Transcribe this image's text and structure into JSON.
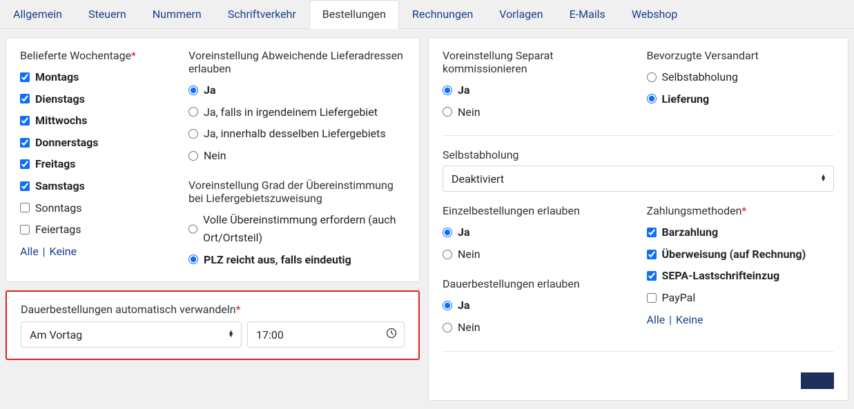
{
  "tabs": {
    "items": [
      {
        "label": "Allgemein",
        "active": false
      },
      {
        "label": "Steuern",
        "active": false
      },
      {
        "label": "Nummern",
        "active": false
      },
      {
        "label": "Schriftverkehr",
        "active": false
      },
      {
        "label": "Bestellungen",
        "active": true
      },
      {
        "label": "Rechnungen",
        "active": false
      },
      {
        "label": "Vorlagen",
        "active": false
      },
      {
        "label": "E-Mails",
        "active": false
      },
      {
        "label": "Webshop",
        "active": false
      }
    ]
  },
  "left": {
    "weekdays": {
      "label": "Belieferte Wochentage",
      "required": true,
      "items": [
        {
          "label": "Montags",
          "checked": true
        },
        {
          "label": "Dienstags",
          "checked": true
        },
        {
          "label": "Mittwochs",
          "checked": true
        },
        {
          "label": "Donnerstags",
          "checked": true
        },
        {
          "label": "Freitags",
          "checked": true
        },
        {
          "label": "Samstags",
          "checked": true
        },
        {
          "label": "Sonntags",
          "checked": false
        },
        {
          "label": "Feiertags",
          "checked": false
        }
      ],
      "all_label": "Alle",
      "none_label": "Keine"
    },
    "delivery_addr": {
      "label": "Voreinstellung Abweichende Lieferadressen erlauben",
      "options": [
        {
          "label": "Ja",
          "selected": true
        },
        {
          "label": "Ja, falls in irgendeinem Liefergebiet",
          "selected": false
        },
        {
          "label": "Ja, innerhalb desselben Liefergebiets",
          "selected": false
        },
        {
          "label": "Nein",
          "selected": false
        }
      ]
    },
    "match_degree": {
      "label": "Voreinstellung Grad der Übereinstimmung bei Liefergebietszuweisung",
      "options": [
        {
          "label": "Volle Übereinstimmung erfordern (auch Ort/Ortsteil)",
          "selected": false
        },
        {
          "label": "PLZ reicht aus, falls eindeutig",
          "selected": true
        }
      ]
    },
    "autoconvert": {
      "label": "Dauerbestellungen automatisch verwandeln",
      "required": true,
      "when_value": "Am Vortag",
      "time_value": "17:00"
    }
  },
  "right": {
    "sep_kom": {
      "label": "Voreinstellung Separat kommissionieren",
      "options": [
        {
          "label": "Ja",
          "selected": true
        },
        {
          "label": "Nein",
          "selected": false
        }
      ]
    },
    "versandart": {
      "label": "Bevorzugte Versandart",
      "options": [
        {
          "label": "Selbstabholung",
          "selected": false
        },
        {
          "label": "Lieferung",
          "selected": true
        }
      ]
    },
    "selbstabholung": {
      "label": "Selbstabholung",
      "value": "Deaktiviert"
    },
    "einzel": {
      "label": "Einzelbestellungen erlauben",
      "options": [
        {
          "label": "Ja",
          "selected": true
        },
        {
          "label": "Nein",
          "selected": false
        }
      ]
    },
    "dauer": {
      "label": "Dauerbestellungen erlauben",
      "options": [
        {
          "label": "Ja",
          "selected": true
        },
        {
          "label": "Nein",
          "selected": false
        }
      ]
    },
    "payment": {
      "label": "Zahlungsmethoden",
      "required": true,
      "items": [
        {
          "label": "Barzahlung",
          "checked": true
        },
        {
          "label": "Überweisung (auf Rechnung)",
          "checked": true
        },
        {
          "label": "SEPA-Lastschrifteinzug",
          "checked": true
        },
        {
          "label": "PayPal",
          "checked": false
        }
      ],
      "all_label": "Alle",
      "none_label": "Keine"
    }
  }
}
